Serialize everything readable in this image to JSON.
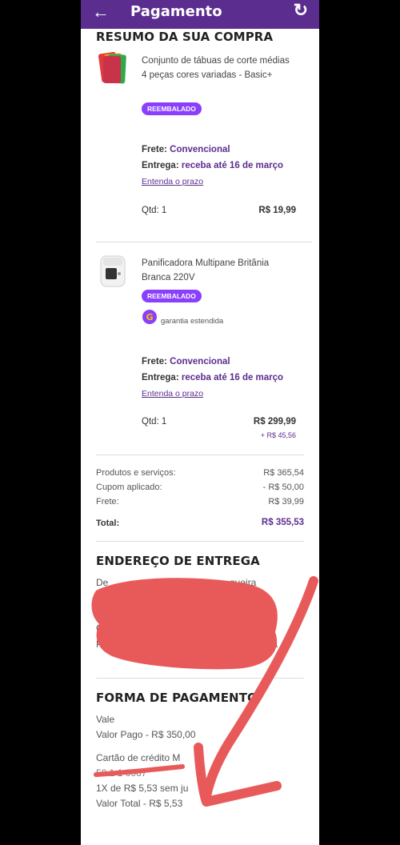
{
  "appbar": {
    "back_icon": "arrow-left-icon",
    "title": "Pagamento",
    "refresh_icon": "refresh-icon",
    "bg_color": "#5b2d8e"
  },
  "summary": {
    "heading": "RESUMO DA SUA COMPRA",
    "items": [
      {
        "name": "Conjunto de tábuas de corte médias 4 peças cores variadas  - Basic+",
        "badge": "REEMBALADO",
        "frete_label": "Frete:",
        "frete_value": "Convencional",
        "entrega_label": "Entrega:",
        "entrega_value": "receba até 16 de março",
        "prazo_link": "Entenda o prazo",
        "qty": "Qtd: 1",
        "price": "R$ 19,99"
      },
      {
        "name": "Panificadora Multipane Britânia Branca 220V",
        "badge": "REEMBALADO",
        "warranty": "garantia estendida",
        "frete_label": "Frete:",
        "frete_value": "Convencional",
        "entrega_label": "Entrega:",
        "entrega_value": "receba até 16 de março",
        "prazo_link": "Entenda o prazo",
        "qty": "Qtd: 1",
        "price": "R$ 299,99",
        "extra": "+ R$ 45,56"
      }
    ],
    "totals": {
      "produtos_label": "Produtos e serviços:",
      "produtos_value": "R$ 365,54",
      "cupom_label": "Cupom aplicado:",
      "cupom_value": "- R$ 50,00",
      "frete_label": "Frete:",
      "frete_value": "R$ 39,99",
      "total_label": "Total:",
      "total_value": "R$ 355,53"
    }
  },
  "address": {
    "heading": "ENDEREÇO DE ENTREGA",
    "line1_start": "De",
    "line1_end": "queira",
    "line2_start": "C",
    "line3_start": "C",
    "line4_start": "Po",
    "line4_end": "Fa"
  },
  "payment": {
    "heading": "FORMA DE PAGAMENTO",
    "method1": "Vale",
    "method1_paid": "Valor Pago - R$ 350,00",
    "method2": "Cartão de crédito M",
    "card_number": "50 1 1   0067",
    "installments": "1X de R$ 5,53 sem ju",
    "total": "Valor Total - R$ 5,53"
  },
  "annotation_color": "#e85a5a"
}
